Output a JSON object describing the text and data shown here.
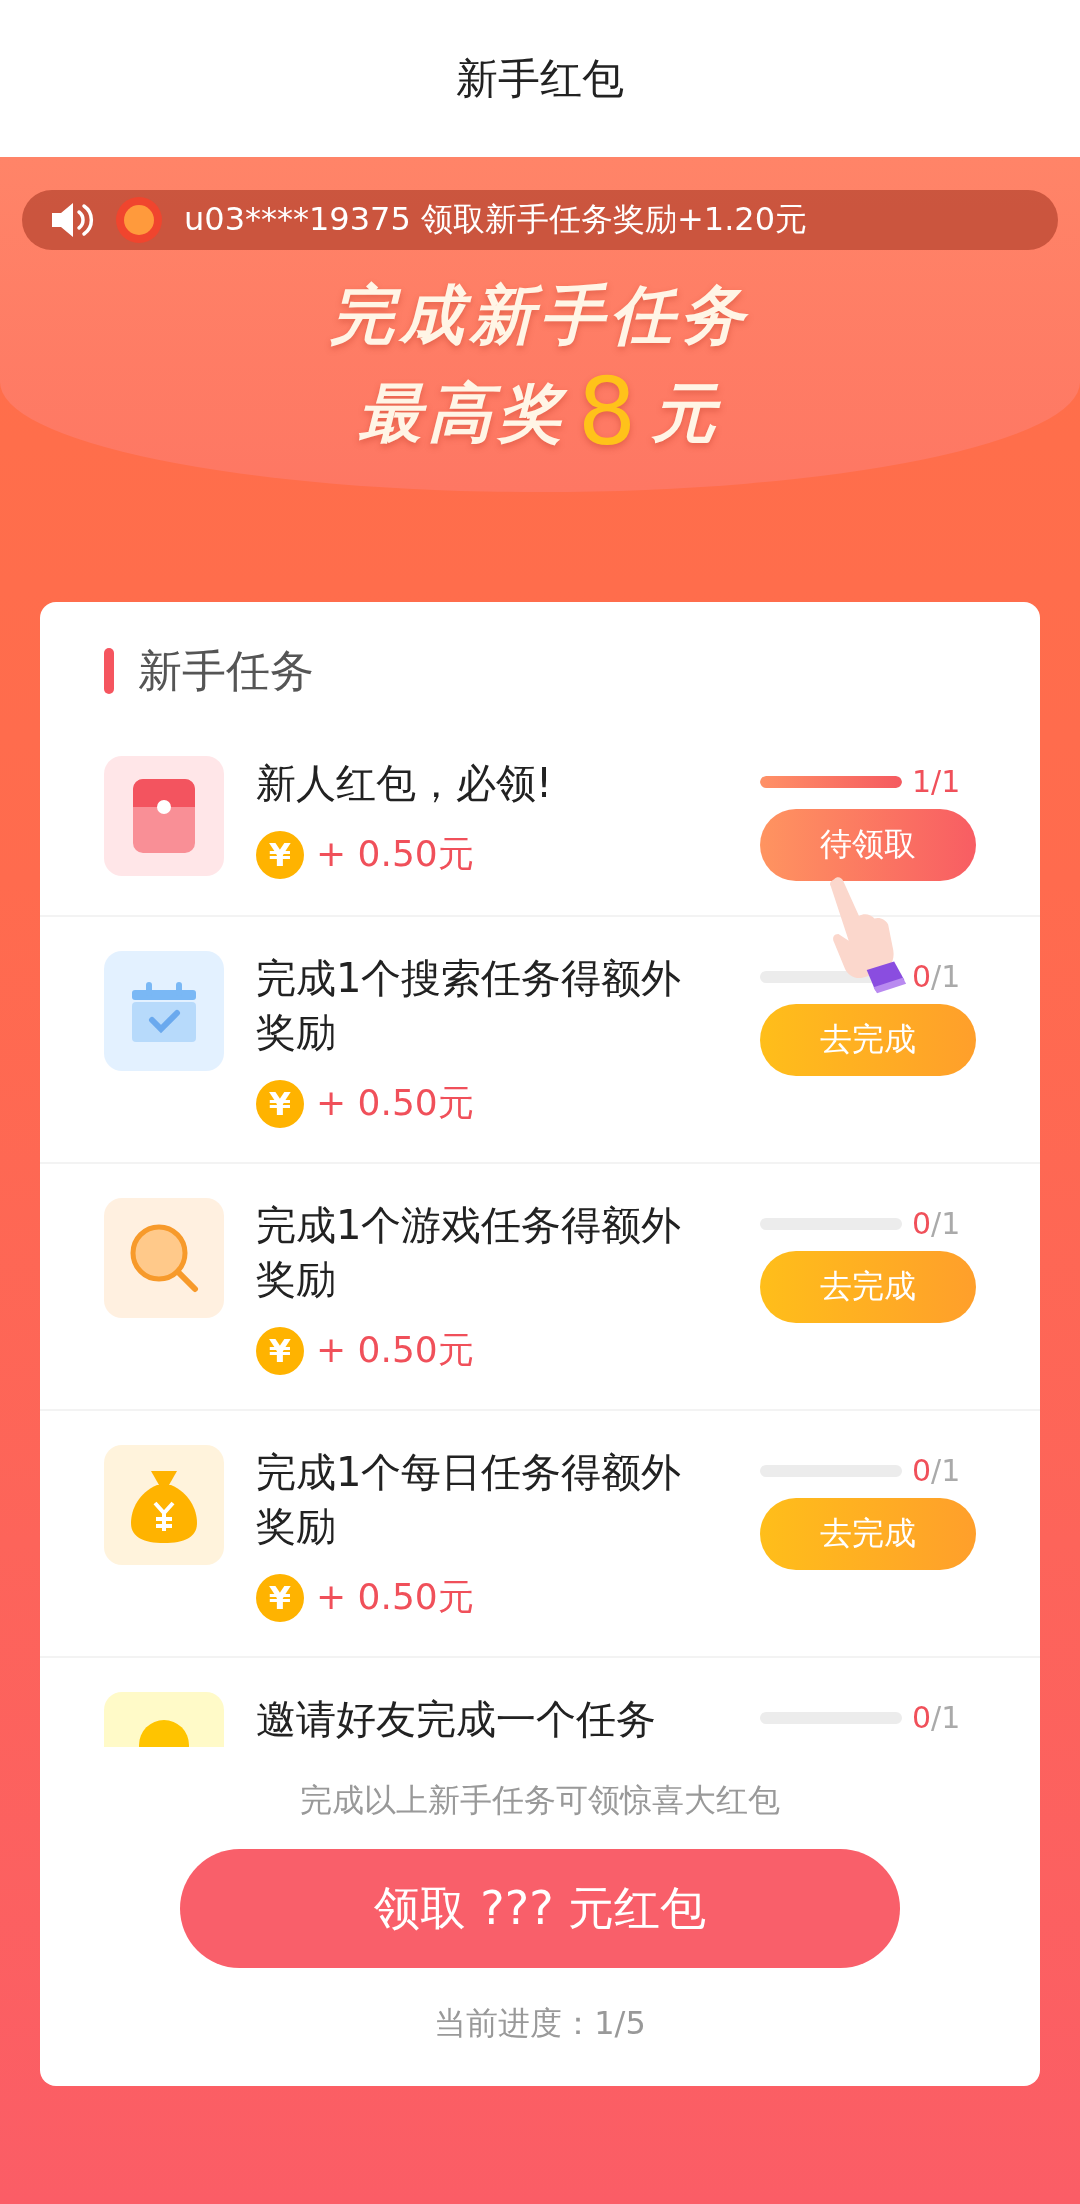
{
  "header": {
    "title": "新手红包"
  },
  "ticker": {
    "user": "u03****19375",
    "message": "领取新手任务奖励+1.20元"
  },
  "headline": {
    "line1": "完成新手任务",
    "prefix": "最高奖",
    "amount": "8",
    "suffix": "元"
  },
  "section": {
    "title": "新手任务"
  },
  "tasks": [
    {
      "title": "新人红包，必领!",
      "coin": "¥",
      "reward": "+ 0.50元",
      "level": 1,
      "done": "1",
      "total": "/1",
      "completed": true,
      "button": {
        "kind": "claim",
        "label": "待领取"
      }
    },
    {
      "title": "完成1个搜索任务得额外奖励",
      "coin": "¥",
      "reward": "+ 0.50元",
      "level": 0,
      "done": "0",
      "total": "/1",
      "completed": false,
      "button": {
        "kind": "go",
        "label": "去完成"
      }
    },
    {
      "title": "完成1个游戏任务得额外奖励",
      "coin": "¥",
      "reward": "+ 0.50元",
      "level": 0,
      "done": "0",
      "total": "/1",
      "completed": false,
      "button": {
        "kind": "go",
        "label": "去完成"
      }
    },
    {
      "title": "完成1个每日任务得额外奖励",
      "coin": "¥",
      "reward": "+ 0.50元",
      "level": 0,
      "done": "0",
      "total": "/1",
      "completed": false,
      "button": {
        "kind": "go",
        "label": "去完成"
      }
    },
    {
      "title": "邀请好友完成一个任务",
      "level": 0,
      "done": "0",
      "total": "/1",
      "completed": false
    }
  ],
  "footer": {
    "hint": "完成以上新手任务可领惊喜大红包",
    "button": "领取 ??? 元红包",
    "progress": "当前进度：1/5"
  }
}
